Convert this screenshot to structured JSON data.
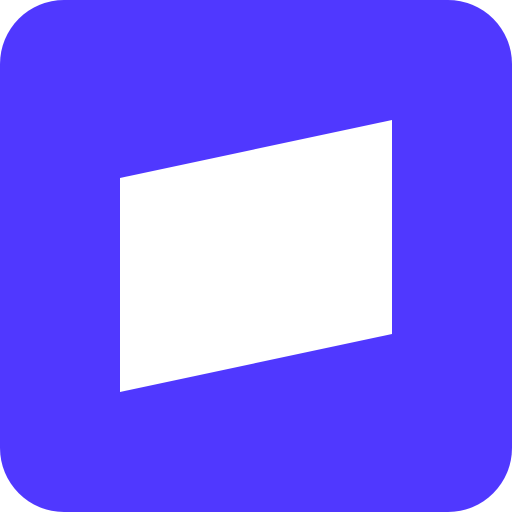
{
  "icon": {
    "name": "parallelogram-logo-icon",
    "background_color": "#5038FF",
    "foreground_color": "#FFFFFF"
  }
}
